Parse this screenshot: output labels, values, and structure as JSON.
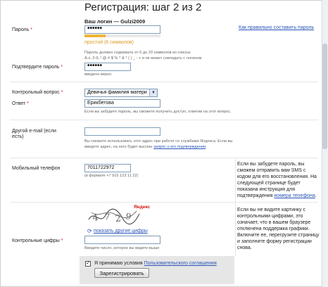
{
  "page": {
    "title": "Регистрация: шаг 2 из 2"
  },
  "login_heading": "Ваш логин — Gulzi2009",
  "password": {
    "label": "Пароль",
    "required_mark": "*",
    "value": "••••••",
    "strength_text": "простой (6 символов)",
    "strength_fraction": 0.28,
    "strength_color": "#f0b43a",
    "help_link": "Как правильно составить пароль",
    "rules_line1": "Пароль должен содержать от 6 до 20 символов из списка:",
    "rules_line2": "A-z, 0-9, ! @ # $ % ^ & * ( ) _ - + и не может совпадать с логином"
  },
  "confirm_password": {
    "label": "Подтвердите пароль",
    "required_mark": "*",
    "value": "••••••",
    "status": "введено верно"
  },
  "security_question": {
    "label": "Контрольный вопрос",
    "required_mark": "*",
    "selected": "Девичья фамилия матери"
  },
  "answer": {
    "label": "Ответ",
    "required_mark": "*",
    "value": "Ерикбетова",
    "note": "Если вы забудете пароль, вы сможете получить доступ, ответив на этот вопрос."
  },
  "other_email": {
    "label_line1": "Другой e-mail (если",
    "label_line2": "есть)",
    "value": "",
    "note_line1": "Вы сможете использовать этот адрес при работе со службами Яндекса. Если вы",
    "note_line2_prefix": "введете адрес, на него будет выслан",
    "note_link": "запрос о его подтверждении",
    "note_line2_suffix": "."
  },
  "mobile": {
    "label": "Мобильный телефон",
    "value": "7011722972",
    "format_hint": "(в формате +7 916 123 11 22)",
    "side_text": "Если вы забудете пароль, вы сможем отправить вам SMS с кодом для его восстановления. На следующей странице будет показана инструкция для подтверждения",
    "side_link": "номера телефона",
    "side_suffix": "."
  },
  "captcha": {
    "label": "Контрольные цифры",
    "required_mark": "*",
    "brand": "Яндекс",
    "refresh_link": "показать другие цифры",
    "value": "",
    "note": "Введите число, которое вы видите выше",
    "side_text": "Если вы не видите картинку с контрольными цифрами, это означает, что в вашем браузере отключена поддержка графики. Включите ее, перегрузите страницу и заполните форму регистрации снова."
  },
  "agreement": {
    "checkbox_mark": "✓",
    "checked": true,
    "text": "Я принимаю условия",
    "link": "Пользовательского соглашения"
  },
  "submit": {
    "label": "Зарегистрировать"
  }
}
